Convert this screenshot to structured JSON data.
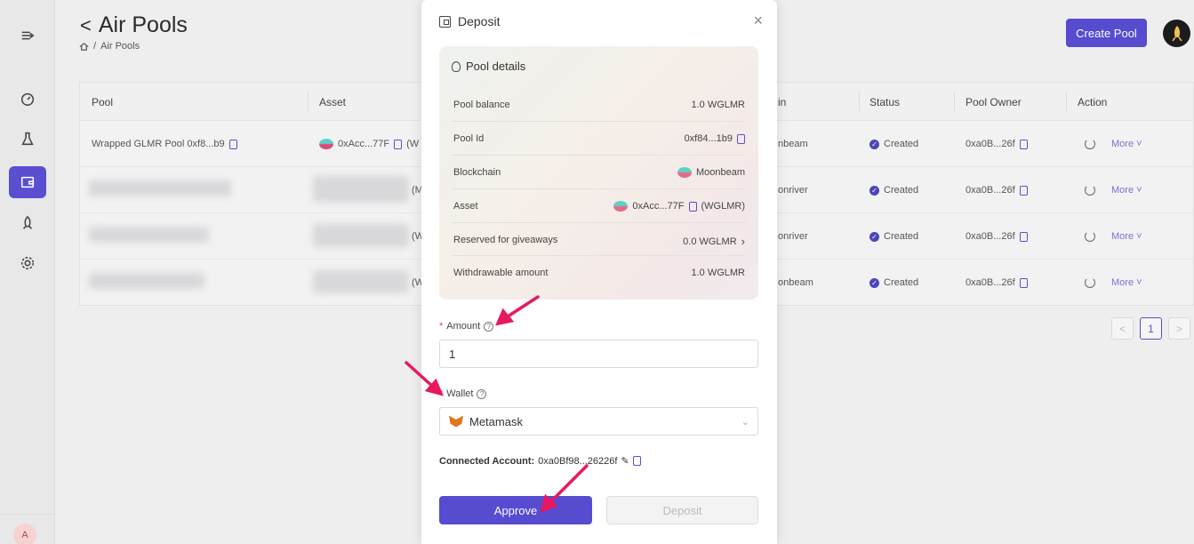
{
  "page": {
    "title": "Air Pools",
    "breadcrumb": "Air Pools",
    "create_label": "Create Pool"
  },
  "sidebar": {
    "avatar_letter": "A",
    "items": [
      {
        "name": "toggle",
        "icon": "sidebar-toggle-icon"
      },
      {
        "name": "dashboard",
        "icon": "dashboard-icon"
      },
      {
        "name": "lab",
        "icon": "flask-icon"
      },
      {
        "name": "pools",
        "icon": "wallet-icon",
        "active": true
      },
      {
        "name": "launch",
        "icon": "rocket-icon"
      },
      {
        "name": "settings",
        "icon": "gear-icon"
      }
    ]
  },
  "table": {
    "headers": [
      "Pool",
      "Asset",
      "in",
      "Status",
      "Pool Owner",
      "Action"
    ],
    "rows": [
      {
        "pool": "Wrapped GLMR Pool 0xf8...b9",
        "asset": "0xAcc...77F",
        "asset_sym": "(W",
        "chain": "nbeam",
        "status": "Created",
        "owner": "0xa0B...26f",
        "more": "More"
      },
      {
        "pool": "",
        "asset": "",
        "asset_sym": "(M",
        "chain": "onriver",
        "status": "Created",
        "owner": "0xa0B...26f",
        "more": "More"
      },
      {
        "pool": "",
        "asset": "",
        "asset_sym": "(W",
        "chain": "onriver",
        "status": "Created",
        "owner": "0xa0B...26f",
        "more": "More"
      },
      {
        "pool": "",
        "asset": "",
        "asset_sym": "(W",
        "chain": "onbeam",
        "status": "Created",
        "owner": "0xa0B...26f",
        "more": "More"
      }
    ],
    "pagination": {
      "prev": "<",
      "current": "1",
      "next": ">"
    }
  },
  "modal": {
    "title": "Deposit",
    "close": "×",
    "pool_details_title": "Pool details",
    "details": [
      {
        "label": "Pool balance",
        "value": "1.0  WGLMR"
      },
      {
        "label": "Pool Id",
        "value": "0xf84...1b9"
      },
      {
        "label": "Blockchain",
        "value": "Moonbeam"
      },
      {
        "label": "Asset",
        "value": "0xAcc...77F",
        "suffix": "(WGLMR)"
      },
      {
        "label": "Reserved for giveaways",
        "value": "0.0  WGLMR"
      },
      {
        "label": "Withdrawable amount",
        "value": "1.0  WGLMR"
      }
    ],
    "amount_label": "Amount",
    "amount_value": "1",
    "wallet_label": "Wallet",
    "wallet_value": "Metamask",
    "connected_label": "Connected Account:",
    "connected_value": "0xa0Bf98...26226f",
    "approve_label": "Approve",
    "deposit_label": "Deposit"
  },
  "colors": {
    "accent": "#574bd0",
    "annotation_arrow": "#e8185c",
    "required": "#e0396a"
  }
}
